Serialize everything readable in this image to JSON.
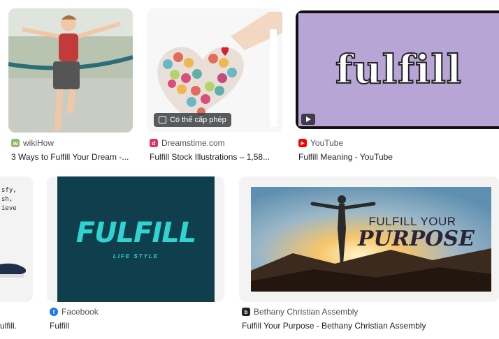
{
  "results": [
    {
      "source": "wikiHow",
      "title": "3 Ways to Fulfill Your Dream -..."
    },
    {
      "source": "Dreamstime.com",
      "title": "Fulfill Stock Illustrations – 1,58...",
      "badge": "Có thể cấp phép"
    },
    {
      "source": "YouTube",
      "title": "Fulfill Meaning - YouTube",
      "overlay_text": "fulfill"
    },
    {
      "snippet": [
        "sfy,",
        "sh,",
        "ieve"
      ],
      "title": "ulfill."
    },
    {
      "source": "Facebook",
      "title": "Fulfill",
      "logo_text": "FULFILL",
      "logo_sub": "LIFE STYLE"
    },
    {
      "source": "Bethany Christian Assembly",
      "title": "Fulfill Your Purpose - Bethany Christian Assembly",
      "overlay_line1": "FULFILL YOUR",
      "overlay_line2": "PURPOSE"
    }
  ],
  "icons": {
    "license": "image-icon",
    "play": "play-icon"
  },
  "colors": {
    "youtube": "#ff0000",
    "facebook": "#1877f2",
    "wikihow": "#93b874",
    "dreamstime": "#e0306e"
  }
}
